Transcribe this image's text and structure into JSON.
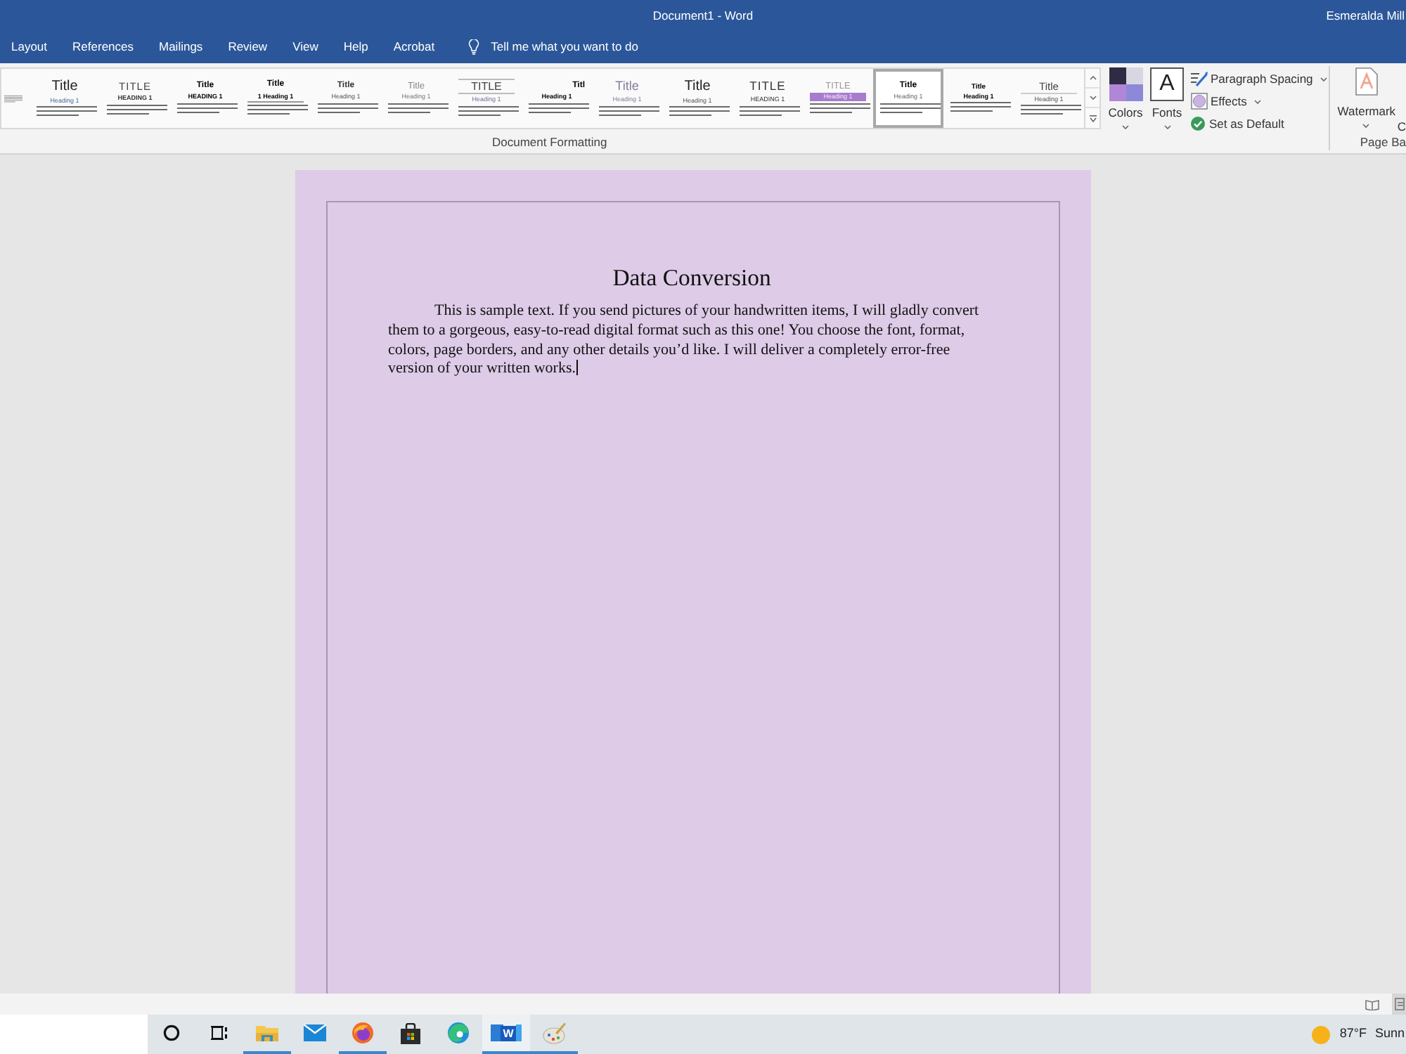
{
  "window": {
    "title": "Document1 - Word",
    "user": "Esmeralda Mill"
  },
  "ribbon_tabs": [
    {
      "label": "Layout",
      "selected": false
    },
    {
      "label": "References",
      "selected": false
    },
    {
      "label": "Mailings",
      "selected": false
    },
    {
      "label": "Review",
      "selected": false
    },
    {
      "label": "View",
      "selected": false
    },
    {
      "label": "Help",
      "selected": false
    },
    {
      "label": "Acrobat",
      "selected": false
    }
  ],
  "tell_me": {
    "placeholder": "Tell me what you want to do"
  },
  "document_formatting": {
    "label": "Document Formatting",
    "styles": [
      {
        "selected": false
      },
      {
        "title": "Title",
        "heading": "Heading 1",
        "selected": false
      },
      {
        "title": "TITLE",
        "heading": "HEADING 1",
        "selected": false
      },
      {
        "title": "Title",
        "heading": "HEADING 1",
        "selected": false
      },
      {
        "title": "Title",
        "heading": "1 Heading 1",
        "selected": false
      },
      {
        "title": "Title",
        "heading": "Heading 1",
        "selected": false
      },
      {
        "title": "Title",
        "heading": "Heading 1",
        "selected": false
      },
      {
        "title": "TITLE",
        "heading": "Heading 1",
        "selected": false
      },
      {
        "title": "Titl",
        "heading": "Heading 1",
        "selected": false
      },
      {
        "title": "Title",
        "heading": "Heading 1",
        "selected": false
      },
      {
        "title": "Title",
        "heading": "Heading 1",
        "selected": false
      },
      {
        "title": "TITLE",
        "heading": "HEADING 1",
        "selected": false
      },
      {
        "title": "TITLE",
        "heading": "Heading 1",
        "selected": false
      },
      {
        "title": "Title",
        "heading": "Heading 1",
        "selected": true
      },
      {
        "title": "Title",
        "heading": "Heading 1",
        "selected": false
      },
      {
        "title": "Title",
        "heading": "Heading 1",
        "selected": false
      }
    ],
    "colors": "Colors",
    "fonts": {
      "glyph": "A",
      "label": "Fonts"
    },
    "paragraph_spacing": "Paragraph Spacing",
    "effects": "Effects",
    "set_as_default": "Set as Default"
  },
  "page_background": {
    "label": "Page Ba",
    "watermark": "Watermark",
    "next_button": "C"
  },
  "document": {
    "title": "Data Conversion",
    "body": "This is sample text. If you send pictures of your handwritten items, I will gladly convert them to a gorgeous, easy-to-read digital format such as this one! You choose the font, format, colors, page borders, and any other details you’d like. I will deliver a completely error-free version of your written works."
  },
  "status_bar": {
    "views": [
      {
        "kind": "read",
        "selected": false
      },
      {
        "kind": "print",
        "selected": true
      }
    ]
  },
  "taskbar": {
    "buttons": [
      {
        "kind": "cortana",
        "running": false,
        "active": false
      },
      {
        "kind": "taskview",
        "running": false,
        "active": false
      },
      {
        "kind": "explorer",
        "running": true,
        "active": false
      },
      {
        "kind": "mail",
        "running": false,
        "active": false
      },
      {
        "kind": "firefox",
        "running": true,
        "active": false
      },
      {
        "kind": "store",
        "running": false,
        "active": false
      },
      {
        "kind": "edge",
        "running": false,
        "active": false
      },
      {
        "kind": "word",
        "glyph": "W",
        "running": true,
        "active": true
      },
      {
        "kind": "paint",
        "running": true,
        "active": false
      }
    ],
    "weather": {
      "temperature": "87°F",
      "condition": "Sunn"
    }
  }
}
